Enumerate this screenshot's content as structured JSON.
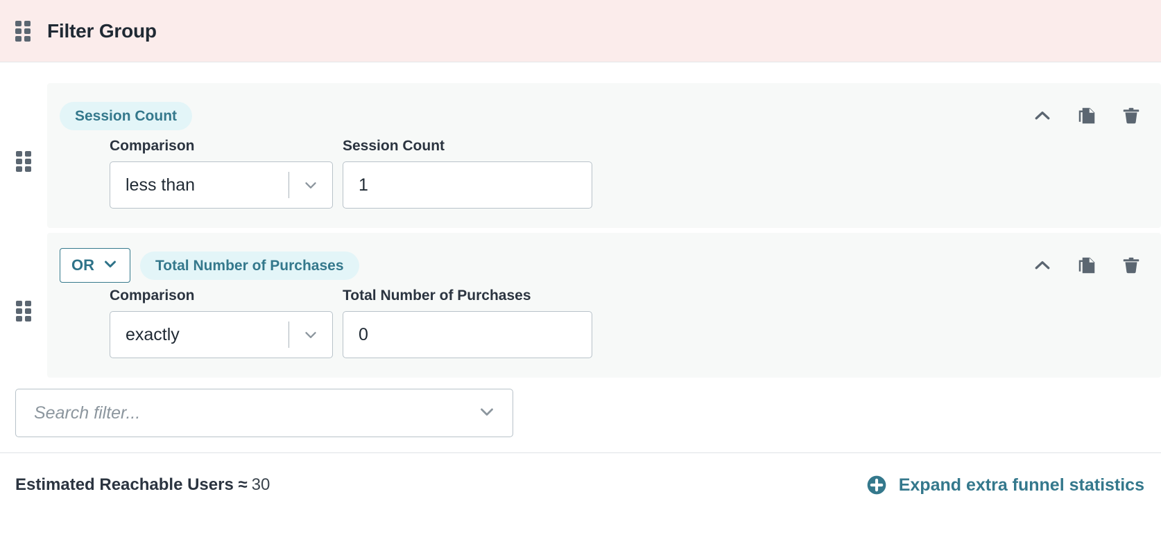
{
  "header": {
    "title": "Filter Group",
    "drag_handle_icon": "drag-handle-icon",
    "background_color": "#fbeceb"
  },
  "theme": {
    "accent": "#34788c",
    "pill_background": "#e3f5f8",
    "card_background": "#f7f9f8",
    "icon_gray": "#5b6671",
    "border_gray": "#b8c2c9"
  },
  "filters": [
    {
      "operator": null,
      "pill_label": "Session Count",
      "comparison_label": "Comparison",
      "comparison_value": "less than",
      "value_label": "Session Count",
      "value": "1",
      "actions": {
        "collapse": "chevron-up-icon",
        "duplicate": "copy-icon",
        "delete": "trash-icon"
      }
    },
    {
      "operator": "OR",
      "pill_label": "Total Number of Purchases",
      "comparison_label": "Comparison",
      "comparison_value": "exactly",
      "value_label": "Total Number of Purchases",
      "value": "0",
      "actions": {
        "collapse": "chevron-up-icon",
        "duplicate": "copy-icon",
        "delete": "trash-icon"
      }
    }
  ],
  "search": {
    "placeholder": "Search filter...",
    "value": "",
    "chevron_icon": "chevron-down-icon"
  },
  "footer": {
    "reach_label": "Estimated Reachable Users ≈",
    "reach_value": "30",
    "expand_label": "Expand extra funnel statistics",
    "expand_icon": "plus-circle-icon"
  }
}
